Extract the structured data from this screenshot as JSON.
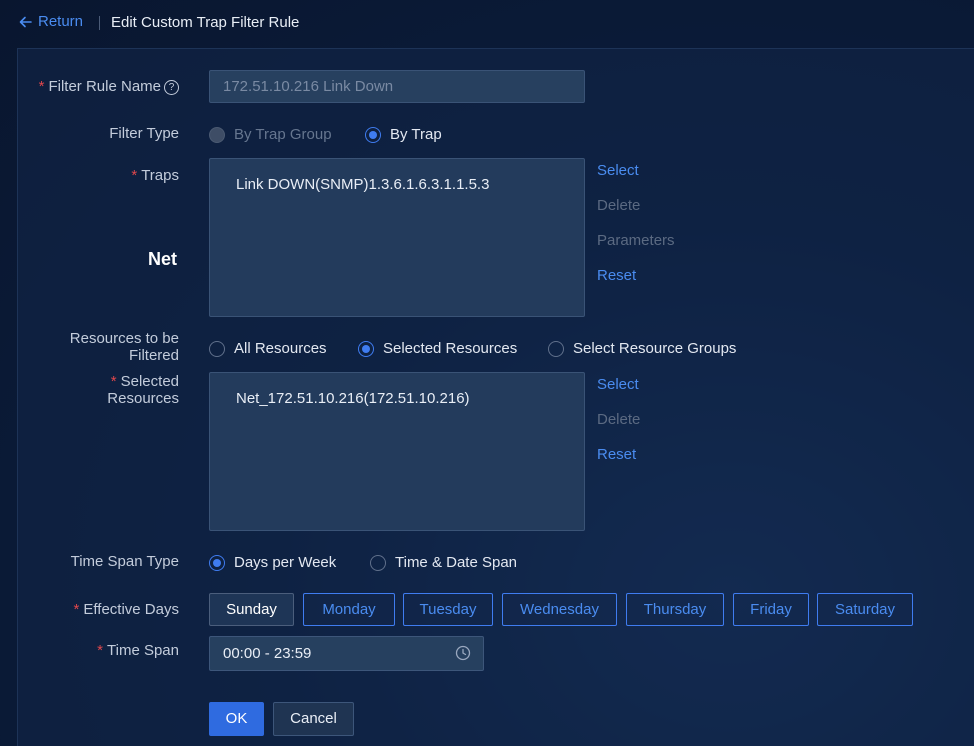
{
  "header": {
    "return_label": "Return",
    "title": "Edit Custom Trap Filter Rule"
  },
  "form": {
    "filter_rule_name": {
      "label": "Filter Rule Name",
      "value": "172.51.10.216 Link Down"
    },
    "filter_type": {
      "label": "Filter Type",
      "options": [
        "By Trap Group",
        "By Trap"
      ],
      "selected": "By Trap"
    },
    "traps": {
      "label": "Traps",
      "items": [
        "Link DOWN(SNMP)1.3.6.1.6.3.1.1.5.3"
      ],
      "actions": [
        "Select",
        "Delete",
        "Parameters",
        "Reset"
      ]
    },
    "net_text": "Net",
    "resources_filter": {
      "label_line1": "Resources to be",
      "label_line2": "Filtered",
      "options": [
        "All Resources",
        "Selected Resources",
        "Select Resource Groups"
      ],
      "selected": "Selected Resources"
    },
    "selected_resources": {
      "label_line1": "Selected",
      "label_line2": "Resources",
      "items": [
        "Net_172.51.10.216(172.51.10.216)"
      ],
      "actions": [
        "Select",
        "Delete",
        "Reset"
      ]
    },
    "time_span_type": {
      "label": "Time Span Type",
      "options": [
        "Days per Week",
        "Time & Date Span"
      ],
      "selected": "Days per Week"
    },
    "effective_days": {
      "label": "Effective Days",
      "days": [
        "Sunday",
        "Monday",
        "Tuesday",
        "Wednesday",
        "Thursday",
        "Friday",
        "Saturday"
      ],
      "selected": "Sunday"
    },
    "time_span": {
      "label": "Time Span",
      "value": "00:00 - 23:59"
    }
  },
  "buttons": {
    "ok": "OK",
    "cancel": "Cancel"
  },
  "colors": {
    "accent": "#3f7cf0",
    "required": "#e0474c",
    "background": "#0b1d3c"
  }
}
